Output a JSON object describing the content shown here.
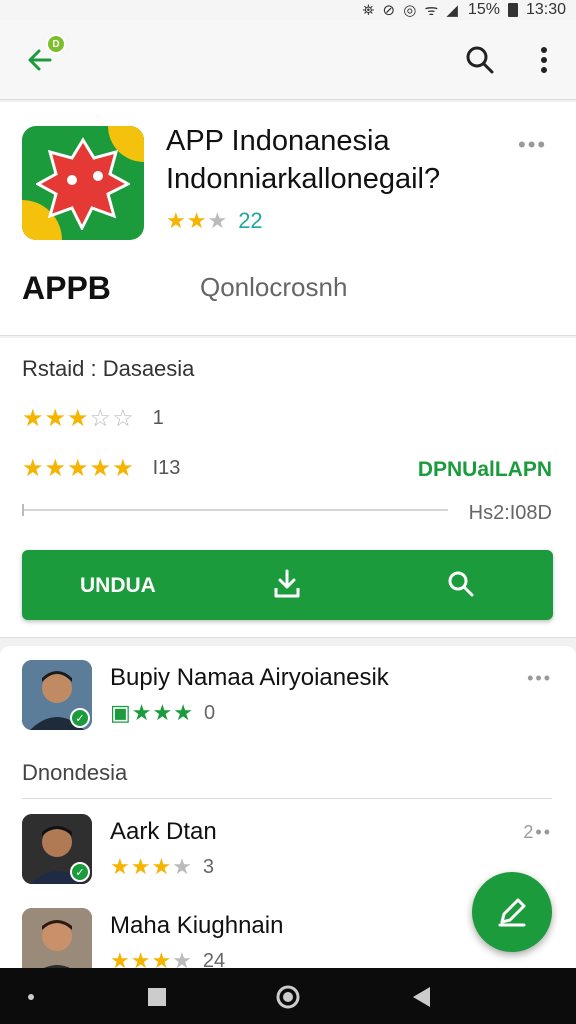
{
  "status_bar": {
    "icons": "⛯ ⊘ ◎ ᯤ ◢",
    "battery": "15%",
    "time": "13:30"
  },
  "app_bar": {
    "back_badge": "D"
  },
  "app": {
    "title_line1": "APP Indonanesia",
    "title_line2": "Indonniarkallonegail?",
    "rating_count": "22",
    "developer": "APPB",
    "category": "Qonlocrosnh",
    "brand_color": "#1b9b3c",
    "top_stars": 3
  },
  "details": {
    "status_label": "Rstaid : Dasaesia",
    "row1_count": "1",
    "row1_stars": 3,
    "row2_count": "I13",
    "row2_stars": 5,
    "download_label": "DPNUalLAPN",
    "size_label": "Hs2:I08D"
  },
  "install_button": {
    "label": "UNDUA"
  },
  "reviews": {
    "section_label": "Dnondesia",
    "items": [
      {
        "name": "Bupiy Namaa Airyoianesik",
        "rating_text": "0",
        "stars": 3,
        "dots": "•••"
      },
      {
        "name": "Aark Dtan",
        "rating_text": "3",
        "stars": 3,
        "dots": "2••"
      },
      {
        "name": "Maha Kiughnain",
        "rating_text": "24",
        "stars": 3,
        "dots": ""
      }
    ]
  }
}
